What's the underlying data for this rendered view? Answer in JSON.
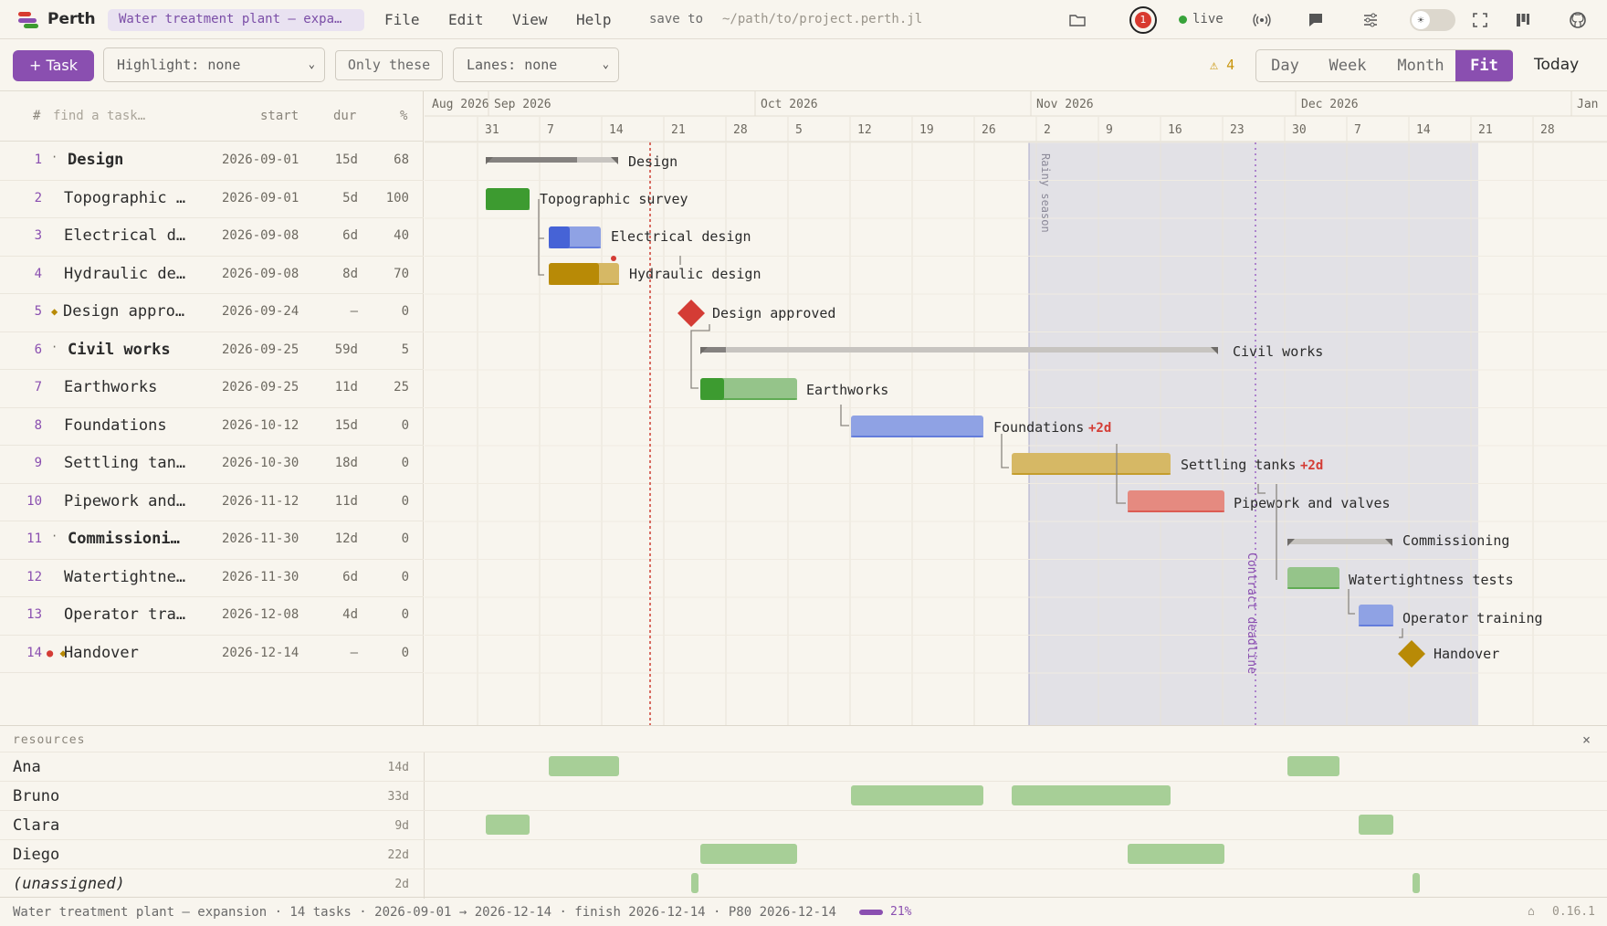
{
  "app": {
    "name": "Perth",
    "project_pill": "Water treatment plant — expa…",
    "menu": [
      "File",
      "Edit",
      "View",
      "Help"
    ],
    "save_to_label": "save to",
    "save_path": "~/path/to/project.perth.jl",
    "notification_count": "1",
    "live_label": "live"
  },
  "toolbar": {
    "add_task_label": "+ Task",
    "highlight": "Highlight: none",
    "only_these": "Only these",
    "lanes": "Lanes: none",
    "warning_count": "4",
    "views": [
      "Day",
      "Week",
      "Month",
      "Fit"
    ],
    "active_view": "Fit",
    "today_label": "Today"
  },
  "table": {
    "headers": {
      "num": "#",
      "search_placeholder": "find a task…",
      "start": "start",
      "dur": "dur",
      "pct": "%"
    },
    "rows": [
      {
        "num": "1",
        "prefix": "·",
        "name": "Design",
        "bold": true,
        "start": "2026-09-01",
        "dur": "15d",
        "pct": "68"
      },
      {
        "num": "2",
        "prefix": "",
        "name": "Topographic …",
        "bold": false,
        "start": "2026-09-01",
        "dur": "5d",
        "pct": "100"
      },
      {
        "num": "3",
        "prefix": "",
        "name": "Electrical d…",
        "bold": false,
        "start": "2026-09-08",
        "dur": "6d",
        "pct": "40"
      },
      {
        "num": "4",
        "prefix": "",
        "name": "Hydraulic de…",
        "bold": false,
        "start": "2026-09-08",
        "dur": "8d",
        "pct": "70"
      },
      {
        "num": "5",
        "prefix": "◆",
        "name": "Design appro…",
        "bold": false,
        "start": "2026-09-24",
        "dur": "—",
        "pct": "0"
      },
      {
        "num": "6",
        "prefix": "·",
        "name": "Civil works",
        "bold": true,
        "start": "2026-09-25",
        "dur": "59d",
        "pct": "5"
      },
      {
        "num": "7",
        "prefix": "",
        "name": "Earthworks",
        "bold": false,
        "start": "2026-09-25",
        "dur": "11d",
        "pct": "25"
      },
      {
        "num": "8",
        "prefix": "",
        "name": "Foundations",
        "bold": false,
        "start": "2026-10-12",
        "dur": "15d",
        "pct": "0"
      },
      {
        "num": "9",
        "prefix": "",
        "name": "Settling tan…",
        "bold": false,
        "start": "2026-10-30",
        "dur": "18d",
        "pct": "0"
      },
      {
        "num": "10",
        "prefix": "",
        "name": "Pipework and…",
        "bold": false,
        "start": "2026-11-12",
        "dur": "11d",
        "pct": "0"
      },
      {
        "num": "11",
        "prefix": "·",
        "name": "Commissioni…",
        "bold": true,
        "start": "2026-11-30",
        "dur": "12d",
        "pct": "0"
      },
      {
        "num": "12",
        "prefix": "",
        "name": "Watertightne…",
        "bold": false,
        "start": "2026-11-30",
        "dur": "6d",
        "pct": "0"
      },
      {
        "num": "13",
        "prefix": "",
        "name": "Operator tra…",
        "bold": false,
        "start": "2026-12-08",
        "dur": "4d",
        "pct": "0"
      },
      {
        "num": "14",
        "prefix": "●◆",
        "name": "Handover",
        "bold": false,
        "start": "2026-12-14",
        "dur": "—",
        "pct": "0"
      }
    ]
  },
  "gantt": {
    "months": [
      "Aug 2026",
      "Sep 2026",
      "Oct 2026",
      "Nov 2026",
      "Dec 2026",
      "Jan"
    ],
    "days": [
      "31",
      "7",
      "14",
      "21",
      "28",
      "5",
      "12",
      "19",
      "26",
      "2",
      "9",
      "16",
      "23",
      "30",
      "7",
      "14",
      "21",
      "28"
    ],
    "bar_labels": [
      "Design",
      "Topographic survey",
      "Electrical design",
      "Hydraulic design",
      "Design approved",
      "Civil works",
      "Earthworks",
      "Foundations",
      "Settling tanks",
      "Pipework and valves",
      "Commissioning",
      "Watertightness tests",
      "Operator training",
      "Handover"
    ],
    "slip_foundations": "+2d",
    "slip_settling": "+2d",
    "rainy_label": "Rainy season",
    "deadline_label": "Contract deadline",
    "colors": {
      "green": "#3d9b30",
      "blue": "#4663d6",
      "gold": "#b88a06",
      "red": "#d43c35",
      "purple": "#8a4fb0"
    }
  },
  "resources": {
    "title": "resources",
    "close": "×",
    "rows": [
      {
        "name": "Ana",
        "days": "14d",
        "italic": false
      },
      {
        "name": "Bruno",
        "days": "33d",
        "italic": false
      },
      {
        "name": "Clara",
        "days": "9d",
        "italic": false
      },
      {
        "name": "Diego",
        "days": "22d",
        "italic": false
      },
      {
        "name": "(unassigned)",
        "days": "2d",
        "italic": true
      }
    ]
  },
  "status": {
    "summary": "Water treatment plant — expansion · 14 tasks · 2026-09-01 → 2026-12-14 · finish 2026-12-14 · P80 2026-12-14",
    "progress": "21%",
    "version": "0.16.1"
  }
}
